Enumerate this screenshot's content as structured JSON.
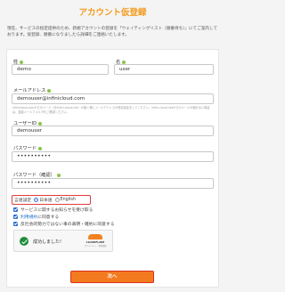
{
  "page": {
    "title": "アカウント仮登録",
    "intro": "現在、サービスの指定提供のため、新規アカウントの登録を「ウェイティングリスト（順番待ち）」にてご案内しております。仮登録、順番になりましたら詳細をご連絡いたします。"
  },
  "form": {
    "last_name": {
      "label": "姓",
      "value": "demo"
    },
    "first_name": {
      "label": "名",
      "value": "user"
    },
    "email": {
      "label": "メールアドレス",
      "value": "demouser@infinicloud.com",
      "hint": "infinicloud.comからのメール（@infini-cloud.net）が届く様にメールアドレスの受信設定をしてください。infini-cloud.netからのメールが届かない場合は、迷惑メールフォルダをご確認ください。"
    },
    "user_id": {
      "label": "ユーザーID",
      "value": "demouser"
    },
    "password": {
      "label": "パスワード",
      "value": "••••••••••"
    },
    "password_confirm": {
      "label": "パスワード（確認）",
      "value": "••••••••••"
    },
    "language": {
      "label": "言語設定",
      "options": [
        "日本語",
        "English"
      ],
      "selected": "日本語"
    },
    "checkboxes": {
      "mail": "サービスに関するお知らせを受け取る",
      "terms_link": "利用規約",
      "terms_rest": "に同意する",
      "antisocial": "反社会的勢力ではない事の表明・確約に同意する"
    },
    "captcha": {
      "status": "成功しました!",
      "brand": "CLOUDFLARE",
      "links": "プライバシー · 利用規約"
    },
    "submit_label": "次へ"
  },
  "colors": {
    "accent": "#f49b1e",
    "button": "#f47a1f",
    "highlight": "#e23b3b",
    "required": "#8bc34a"
  }
}
